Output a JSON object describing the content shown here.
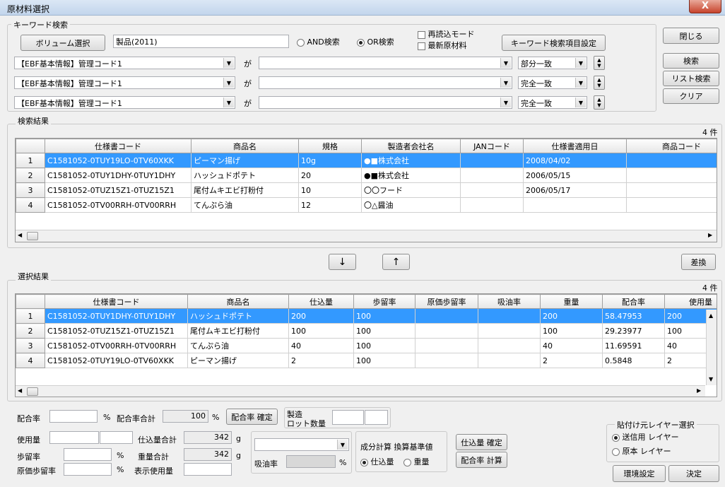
{
  "window": {
    "title": "原材料選択",
    "close_glyph": "X"
  },
  "keyword": {
    "group_label": "キーワード検索",
    "volume_button": "ボリューム選択",
    "volume_value": "製品(2011)",
    "and_label": "AND検索",
    "or_label": "OR検索",
    "reread_label": "再読込モード",
    "latest_label": "最新原材料",
    "settings_button": "キーワード検索項目設定",
    "ga": "が",
    "rows": [
      {
        "field": "【EBF基本情報】管理コード1",
        "value": "",
        "match": "部分一致"
      },
      {
        "field": "【EBF基本情報】管理コード1",
        "value": "",
        "match": "完全一致"
      },
      {
        "field": "【EBF基本情報】管理コード1",
        "value": "",
        "match": "完全一致"
      }
    ]
  },
  "side_buttons": {
    "close": "閉じる",
    "search": "検索",
    "list_search": "リスト検索",
    "clear": "クリア"
  },
  "search_results": {
    "group_label": "検索結果",
    "count": "4 件",
    "columns": [
      "仕様書コード",
      "商品名",
      "規格",
      "製造者会社名",
      "JANコード",
      "仕様書適用日",
      "商品コード"
    ],
    "rows": [
      {
        "no": "1",
        "cells": [
          "C1581052-0TUY19LO-0TV60XKK",
          "ピーマン揚げ",
          "10g",
          "●■株式会社",
          "",
          "2008/04/02",
          ""
        ]
      },
      {
        "no": "2",
        "cells": [
          "C1581052-0TUY1DHY-0TUY1DHY",
          "ハッシュドポテト",
          "20",
          "●■株式会社",
          "",
          "2006/05/15",
          ""
        ]
      },
      {
        "no": "3",
        "cells": [
          "C1581052-0TUZ15Z1-0TUZ15Z1",
          "尾付ムキエビ打粉付",
          "10",
          "〇〇フード",
          "",
          "2006/05/17",
          ""
        ]
      },
      {
        "no": "4",
        "cells": [
          "C1581052-0TV00RRH-0TV00RRH",
          "てんぷら油",
          "12",
          "〇△醤油",
          "",
          "",
          ""
        ]
      }
    ]
  },
  "mid_buttons": {
    "down": "↓",
    "up": "↑",
    "swap": "差換"
  },
  "selection_results": {
    "group_label": "選択結果",
    "count": "4 件",
    "columns": [
      "仕様書コード",
      "商品名",
      "仕込量",
      "歩留率",
      "原価歩留率",
      "吸油率",
      "重量",
      "配合率",
      "使用量"
    ],
    "rows": [
      {
        "no": "1",
        "cells": [
          "C1581052-0TUY1DHY-0TUY1DHY",
          "ハッシュドポテト",
          "200",
          "100",
          "",
          "",
          "200",
          "58.47953",
          "200"
        ]
      },
      {
        "no": "2",
        "cells": [
          "C1581052-0TUZ15Z1-0TUZ15Z1",
          "尾付ムキエビ打粉付",
          "100",
          "100",
          "",
          "",
          "100",
          "29.23977",
          "100"
        ]
      },
      {
        "no": "3",
        "cells": [
          "C1581052-0TV00RRH-0TV00RRH",
          "てんぷら油",
          "40",
          "100",
          "",
          "",
          "40",
          "11.69591",
          "40"
        ]
      },
      {
        "no": "4",
        "cells": [
          "C1581052-0TUY19LO-0TV60XKK",
          "ピーマン揚げ",
          "2",
          "100",
          "",
          "",
          "2",
          "0.5848",
          "2"
        ]
      }
    ]
  },
  "bottom": {
    "ratio_label": "配合率",
    "percent": "%",
    "ratio_total_label": "配合率合計",
    "ratio_total_value": "100",
    "ratio_confirm": "配合率 確定",
    "lot_label_1": "製造",
    "lot_label_2": "ロット数量",
    "usage_label": "使用量",
    "prep_total_label": "仕込量合計",
    "prep_total_value": "342",
    "g": "g",
    "yield_label": "歩留率",
    "weight_total_label": "重量合計",
    "weight_total_value": "342",
    "cost_yield_label": "原価歩留率",
    "display_usage_label": "表示使用量",
    "oil_label": "吸油率",
    "calc_group_label": "成分計算 換算基準値",
    "calc_prep": "仕込量",
    "calc_weight": "重量",
    "prep_confirm": "仕込量 確定",
    "ratio_calc": "配合率 計算",
    "layer_group_label": "貼付け元レイヤー選択",
    "layer_send": "送信用 レイヤー",
    "layer_orig": "原本 レイヤー",
    "env_button": "環境設定",
    "ok_button": "決定"
  }
}
